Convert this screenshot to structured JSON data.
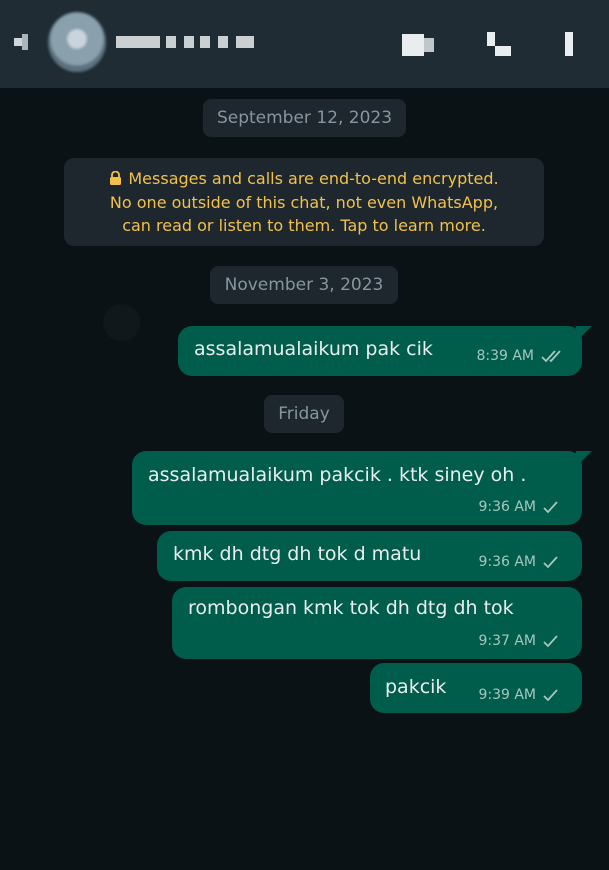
{
  "header": {
    "back_icon": "arrow-back-icon",
    "avatar_icon": "avatar",
    "actions": [
      "video-call-icon",
      "voice-call-icon",
      "more-options-icon"
    ]
  },
  "chat": {
    "date_chip_1": "September 12, 2023",
    "encryption": {
      "icon": "lock-icon",
      "line1": "Messages and calls are end-to-end encrypted.",
      "line2": "No one outside of this chat, not even WhatsApp,",
      "line3": "can read or listen to them. Tap to learn more."
    },
    "date_chip_2": "November 3, 2023",
    "date_chip_3": "Friday",
    "messages": [
      {
        "text": "assalamualaikum pak cik",
        "time": "8:39 AM",
        "status": "double-check-icon"
      },
      {
        "text": "assalamualaikum pakcik . ktk siney oh .",
        "time": "9:36 AM",
        "status": "check-icon"
      },
      {
        "text": "kmk dh dtg dh tok d matu",
        "time": "9:36 AM",
        "status": "check-icon"
      },
      {
        "text": "rombongan kmk tok dh dtg dh tok",
        "time": "9:37 AM",
        "status": "check-icon"
      },
      {
        "text": "pakcik",
        "time": "9:39 AM",
        "status": "check-icon"
      }
    ]
  },
  "colors": {
    "header_bg": "#1f2c33",
    "chat_bg": "#0b1216",
    "outgoing_bubble": "#005c4b",
    "chip_bg": "#1d272d",
    "encryption_text": "#f2c14b"
  }
}
